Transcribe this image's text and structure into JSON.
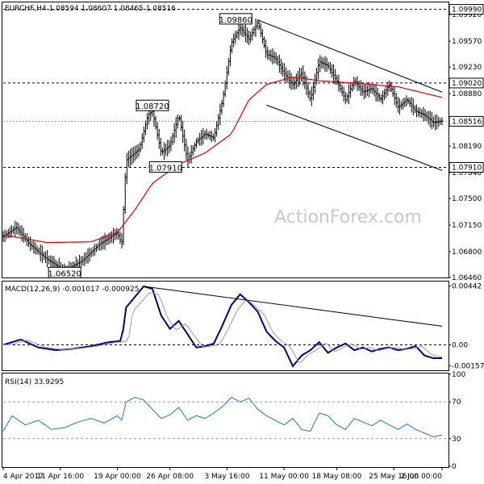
{
  "watermark": "ActionForex.com",
  "chart_data": {
    "type": "candlestick",
    "price_panel": {
      "title": "EURCHF,H4  1.08594 1.08607 1.08465 1.08516",
      "ylim": [
        1.0646,
        1.1006
      ],
      "y_ticks": [
        "1.09920",
        "1.09570",
        "1.09230",
        "1.08880",
        "1.08540",
        "1.08190",
        "1.07840",
        "1.07500",
        "1.07150",
        "1.06800",
        "1.06460"
      ],
      "y_tick_values": [
        1.0992,
        1.0957,
        1.0923,
        1.0888,
        1.0854,
        1.0819,
        1.0784,
        1.075,
        1.0715,
        1.068,
        1.0646
      ],
      "levels": [
        {
          "label": "1.09990",
          "value": 1.0999
        },
        {
          "label": "1.09020",
          "value": 1.0902
        },
        {
          "label": "1.07910",
          "value": 1.0791
        }
      ],
      "current": {
        "label": "1.08516",
        "value": 1.08516
      },
      "annotations": [
        {
          "label": "1.09860",
          "t": 0.53,
          "value": 1.0986
        },
        {
          "label": "1.08720",
          "t": 0.34,
          "value": 1.0872
        },
        {
          "label": "1.07910",
          "t": 0.37,
          "value": 1.0791
        },
        {
          "label": "1.06520",
          "t": 0.14,
          "value": 1.0652
        }
      ],
      "ma_anchors": [
        [
          0,
          1.0702
        ],
        [
          0.1,
          1.0692
        ],
        [
          0.2,
          1.0693
        ],
        [
          0.26,
          1.0705
        ],
        [
          0.3,
          1.0735
        ],
        [
          0.34,
          1.077
        ],
        [
          0.4,
          1.0795
        ],
        [
          0.46,
          1.081
        ],
        [
          0.52,
          1.0835
        ],
        [
          0.56,
          1.088
        ],
        [
          0.6,
          1.09
        ],
        [
          0.66,
          1.091
        ],
        [
          0.72,
          1.0905
        ],
        [
          0.8,
          1.0902
        ],
        [
          0.9,
          1.0897
        ],
        [
          1,
          1.0883
        ]
      ],
      "trendlines": [
        {
          "from": [
            0.58,
            1.0985
          ],
          "to": [
            1.0,
            1.089
          ]
        },
        {
          "from": [
            0.6,
            1.0873
          ],
          "to": [
            1.0,
            1.0787
          ]
        }
      ],
      "price_path": [
        [
          0,
          1.07
        ],
        [
          0.03,
          1.0712
        ],
        [
          0.06,
          1.069
        ],
        [
          0.1,
          1.067
        ],
        [
          0.14,
          1.0655
        ],
        [
          0.18,
          1.0668
        ],
        [
          0.22,
          1.069
        ],
        [
          0.26,
          1.0705
        ],
        [
          0.27,
          1.069
        ],
        [
          0.28,
          1.08
        ],
        [
          0.31,
          1.0815
        ],
        [
          0.33,
          1.086
        ],
        [
          0.34,
          1.0865
        ],
        [
          0.36,
          1.081
        ],
        [
          0.38,
          1.082
        ],
        [
          0.4,
          1.086
        ],
        [
          0.42,
          1.08
        ],
        [
          0.44,
          1.0825
        ],
        [
          0.46,
          1.0835
        ],
        [
          0.48,
          1.083
        ],
        [
          0.5,
          1.088
        ],
        [
          0.52,
          1.0955
        ],
        [
          0.54,
          1.0975
        ],
        [
          0.56,
          1.096
        ],
        [
          0.58,
          1.0982
        ],
        [
          0.6,
          1.094
        ],
        [
          0.62,
          1.0935
        ],
        [
          0.64,
          1.0915
        ],
        [
          0.66,
          1.09
        ],
        [
          0.68,
          1.0915
        ],
        [
          0.7,
          1.088
        ],
        [
          0.72,
          1.093
        ],
        [
          0.74,
          1.0925
        ],
        [
          0.76,
          1.0905
        ],
        [
          0.78,
          1.088
        ],
        [
          0.8,
          1.0905
        ],
        [
          0.82,
          1.089
        ],
        [
          0.84,
          1.0895
        ],
        [
          0.86,
          1.088
        ],
        [
          0.88,
          1.09
        ],
        [
          0.9,
          1.087
        ],
        [
          0.92,
          1.088
        ],
        [
          0.94,
          1.0865
        ],
        [
          0.96,
          1.086
        ],
        [
          0.98,
          1.085
        ],
        [
          1,
          1.0852
        ]
      ]
    },
    "macd_panel": {
      "title": "MACD(12,26,9) -0.001017 -0.000925",
      "ylim": [
        -0.00185,
        0.0047
      ],
      "y_ticks": [
        "0.00442",
        "0.00",
        "-0.001578"
      ],
      "y_tick_values": [
        0.00442,
        0.0,
        -0.001578
      ],
      "macd_anchors": [
        [
          0,
          0
        ],
        [
          0.04,
          0.0004
        ],
        [
          0.08,
          -0.0002
        ],
        [
          0.12,
          -0.0004
        ],
        [
          0.16,
          -0.0003
        ],
        [
          0.2,
          -0.0001
        ],
        [
          0.24,
          0.0002
        ],
        [
          0.27,
          0.0003
        ],
        [
          0.28,
          0.0028
        ],
        [
          0.3,
          0.0036
        ],
        [
          0.32,
          0.0044
        ],
        [
          0.34,
          0.0042
        ],
        [
          0.36,
          0.0022
        ],
        [
          0.38,
          0.0012
        ],
        [
          0.4,
          0.0018
        ],
        [
          0.42,
          0.0008
        ],
        [
          0.44,
          -0.0002
        ],
        [
          0.46,
          -0.0001
        ],
        [
          0.48,
          0.0001
        ],
        [
          0.5,
          0.0015
        ],
        [
          0.52,
          0.003
        ],
        [
          0.54,
          0.0038
        ],
        [
          0.56,
          0.0032
        ],
        [
          0.58,
          0.0025
        ],
        [
          0.6,
          0.001
        ],
        [
          0.62,
          0.0003
        ],
        [
          0.64,
          -0.0002
        ],
        [
          0.66,
          -0.0016
        ],
        [
          0.68,
          -0.0008
        ],
        [
          0.7,
          -0.0004
        ],
        [
          0.72,
          0.0002
        ],
        [
          0.74,
          -0.0006
        ],
        [
          0.76,
          -0.0002
        ],
        [
          0.78,
          0.0001
        ],
        [
          0.8,
          -0.0004
        ],
        [
          0.82,
          -0.0002
        ],
        [
          0.84,
          -0.0005
        ],
        [
          0.86,
          -0.0003
        ],
        [
          0.88,
          -0.0002
        ],
        [
          0.9,
          -0.0004
        ],
        [
          0.92,
          -0.0003
        ],
        [
          0.94,
          -0.0001
        ],
        [
          0.96,
          -0.0008
        ],
        [
          0.98,
          -0.001
        ],
        [
          1,
          -0.001
        ]
      ],
      "trendline": {
        "from": [
          0.32,
          0.0044
        ],
        "to": [
          1.0,
          0.0014
        ]
      }
    },
    "rsi_panel": {
      "title": "RSI(14) 33.9295",
      "ylim": [
        0,
        100
      ],
      "y_ticks": [
        "100",
        "70",
        "30",
        "0"
      ],
      "y_tick_values": [
        100,
        70,
        30,
        0
      ],
      "levels": [
        70,
        30
      ],
      "rsi_anchors": [
        [
          0,
          38
        ],
        [
          0.02,
          55
        ],
        [
          0.05,
          45
        ],
        [
          0.08,
          50
        ],
        [
          0.11,
          40
        ],
        [
          0.14,
          42
        ],
        [
          0.17,
          48
        ],
        [
          0.2,
          52
        ],
        [
          0.23,
          47
        ],
        [
          0.26,
          55
        ],
        [
          0.27,
          50
        ],
        [
          0.28,
          70
        ],
        [
          0.3,
          75
        ],
        [
          0.32,
          72
        ],
        [
          0.34,
          62
        ],
        [
          0.36,
          52
        ],
        [
          0.38,
          56
        ],
        [
          0.4,
          64
        ],
        [
          0.42,
          50
        ],
        [
          0.44,
          55
        ],
        [
          0.46,
          52
        ],
        [
          0.48,
          58
        ],
        [
          0.5,
          65
        ],
        [
          0.52,
          75
        ],
        [
          0.54,
          70
        ],
        [
          0.56,
          74
        ],
        [
          0.58,
          62
        ],
        [
          0.6,
          55
        ],
        [
          0.62,
          50
        ],
        [
          0.64,
          45
        ],
        [
          0.66,
          52
        ],
        [
          0.68,
          40
        ],
        [
          0.7,
          38
        ],
        [
          0.72,
          58
        ],
        [
          0.74,
          55
        ],
        [
          0.76,
          45
        ],
        [
          0.78,
          40
        ],
        [
          0.8,
          52
        ],
        [
          0.82,
          48
        ],
        [
          0.84,
          44
        ],
        [
          0.86,
          50
        ],
        [
          0.88,
          45
        ],
        [
          0.9,
          40
        ],
        [
          0.92,
          46
        ],
        [
          0.94,
          40
        ],
        [
          0.96,
          36
        ],
        [
          0.98,
          32
        ],
        [
          1,
          34
        ]
      ]
    },
    "x_ticks": [
      "4 Apr 2017",
      "11 Apr 16:00",
      "19 Apr 00:00",
      "26 Apr 08:00",
      "3 May 16:00",
      "11 May 00:00",
      "18 May 08:00",
      "25 May 16:00",
      "2 Jun 00:00"
    ],
    "x_tick_t": [
      0.0,
      0.13,
      0.26,
      0.38,
      0.51,
      0.64,
      0.76,
      0.89,
      1.0
    ]
  }
}
